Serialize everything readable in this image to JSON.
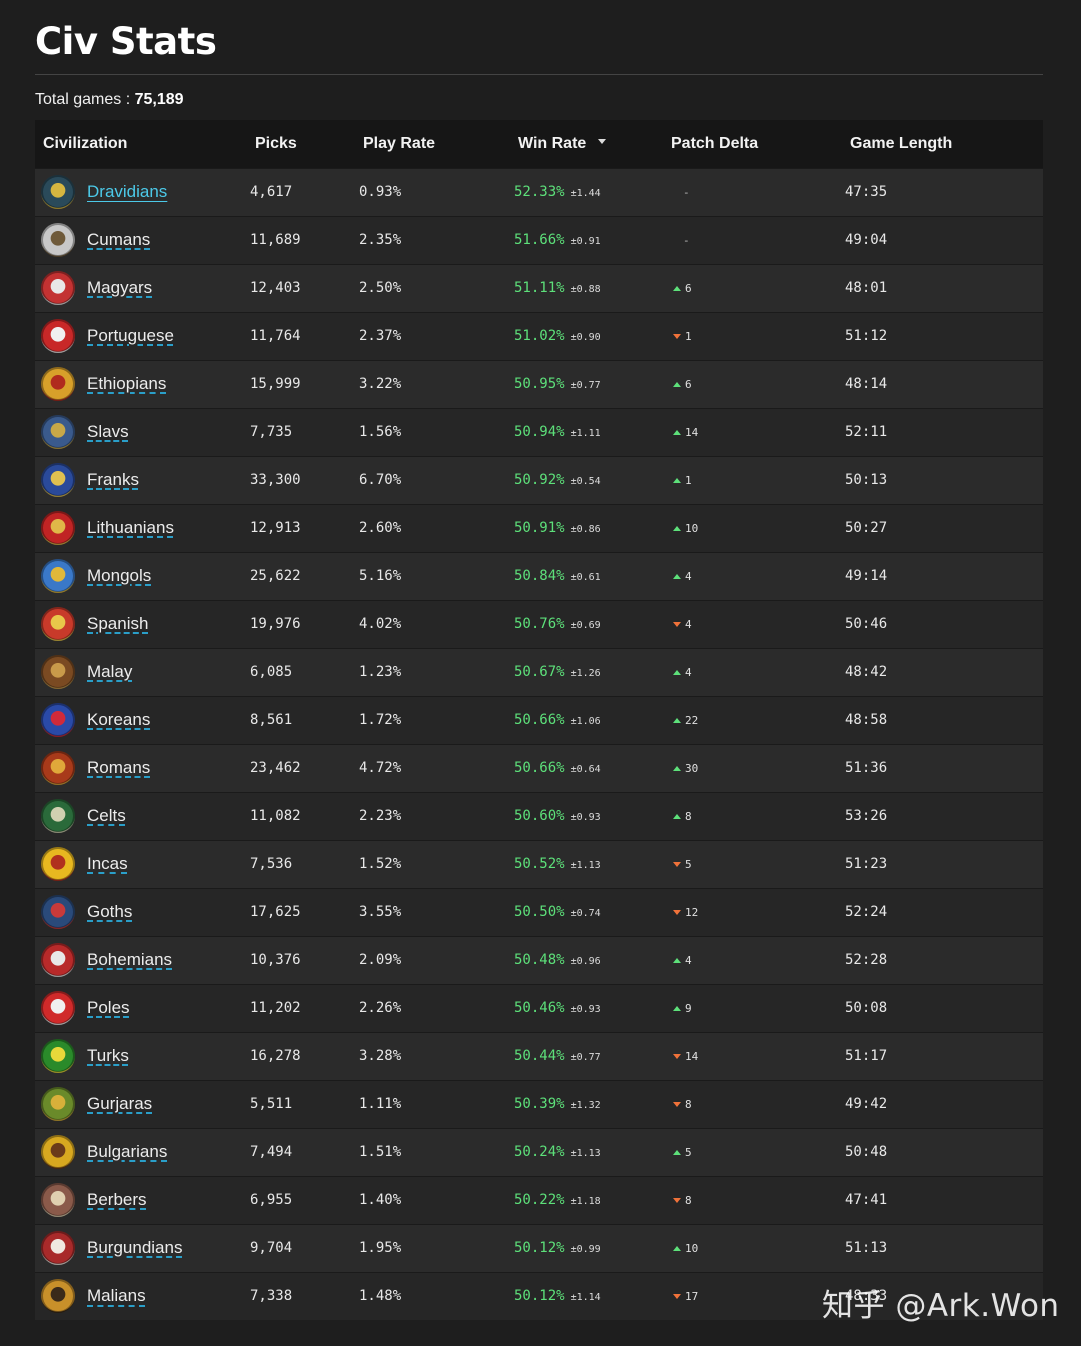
{
  "page": {
    "title": "Civ Stats",
    "total_label": "Total games : ",
    "total_value": "75,189"
  },
  "table": {
    "headers": {
      "civilization": "Civilization",
      "picks": "Picks",
      "play_rate": "Play Rate",
      "win_rate": "Win Rate",
      "patch_delta": "Patch Delta",
      "game_length": "Game Length"
    },
    "sorted_by": "win_rate",
    "rows": [
      {
        "civ": "Dravidians",
        "picks": "4,617",
        "play_rate": "0.93%",
        "win_rate": "52.33%",
        "ci": "±1.44",
        "delta_dir": "none",
        "delta": "-",
        "length": "47:35",
        "colors": [
          "#2a4a5a",
          "#d6b640"
        ]
      },
      {
        "civ": "Cumans",
        "picks": "11,689",
        "play_rate": "2.35%",
        "win_rate": "51.66%",
        "ci": "±0.91",
        "delta_dir": "none",
        "delta": "-",
        "length": "49:04",
        "colors": [
          "#c8c8c8",
          "#6f5a3a"
        ]
      },
      {
        "civ": "Magyars",
        "picks": "12,403",
        "play_rate": "2.50%",
        "win_rate": "51.11%",
        "ci": "±0.88",
        "delta_dir": "up",
        "delta": "6",
        "length": "48:01",
        "colors": [
          "#c33232",
          "#e8e8e8"
        ]
      },
      {
        "civ": "Portuguese",
        "picks": "11,764",
        "play_rate": "2.37%",
        "win_rate": "51.02%",
        "ci": "±0.90",
        "delta_dir": "down",
        "delta": "1",
        "length": "51:12",
        "colors": [
          "#c82828",
          "#f0f0f0"
        ]
      },
      {
        "civ": "Ethiopians",
        "picks": "15,999",
        "play_rate": "3.22%",
        "win_rate": "50.95%",
        "ci": "±0.77",
        "delta_dir": "up",
        "delta": "6",
        "length": "48:14",
        "colors": [
          "#d8a02a",
          "#b02a1e"
        ]
      },
      {
        "civ": "Slavs",
        "picks": "7,735",
        "play_rate": "1.56%",
        "win_rate": "50.94%",
        "ci": "±1.11",
        "delta_dir": "up",
        "delta": "14",
        "length": "52:11",
        "colors": [
          "#3a5a8c",
          "#c8a848"
        ]
      },
      {
        "civ": "Franks",
        "picks": "33,300",
        "play_rate": "6.70%",
        "win_rate": "50.92%",
        "ci": "±0.54",
        "delta_dir": "up",
        "delta": "1",
        "length": "50:13",
        "colors": [
          "#2a4a9a",
          "#e0c050"
        ]
      },
      {
        "civ": "Lithuanians",
        "picks": "12,913",
        "play_rate": "2.60%",
        "win_rate": "50.91%",
        "ci": "±0.86",
        "delta_dir": "up",
        "delta": "10",
        "length": "50:27",
        "colors": [
          "#c02424",
          "#e0b848"
        ]
      },
      {
        "civ": "Mongols",
        "picks": "25,622",
        "play_rate": "5.16%",
        "win_rate": "50.84%",
        "ci": "±0.61",
        "delta_dir": "up",
        "delta": "4",
        "length": "49:14",
        "colors": [
          "#3a78c8",
          "#e0b83a"
        ]
      },
      {
        "civ": "Spanish",
        "picks": "19,976",
        "play_rate": "4.02%",
        "win_rate": "50.76%",
        "ci": "±0.69",
        "delta_dir": "down",
        "delta": "4",
        "length": "50:46",
        "colors": [
          "#c83a2a",
          "#e8c84a"
        ]
      },
      {
        "civ": "Malay",
        "picks": "6,085",
        "play_rate": "1.23%",
        "win_rate": "50.67%",
        "ci": "±1.26",
        "delta_dir": "up",
        "delta": "4",
        "length": "48:42",
        "colors": [
          "#7a4a22",
          "#c89a4a"
        ]
      },
      {
        "civ": "Koreans",
        "picks": "8,561",
        "play_rate": "1.72%",
        "win_rate": "50.66%",
        "ci": "±1.06",
        "delta_dir": "up",
        "delta": "22",
        "length": "48:58",
        "colors": [
          "#2a4aa8",
          "#d02a3a"
        ]
      },
      {
        "civ": "Romans",
        "picks": "23,462",
        "play_rate": "4.72%",
        "win_rate": "50.66%",
        "ci": "±0.64",
        "delta_dir": "up",
        "delta": "30",
        "length": "51:36",
        "colors": [
          "#a83a1a",
          "#e0a83a"
        ]
      },
      {
        "civ": "Celts",
        "picks": "11,082",
        "play_rate": "2.23%",
        "win_rate": "50.60%",
        "ci": "±0.93",
        "delta_dir": "up",
        "delta": "8",
        "length": "53:26",
        "colors": [
          "#2a6a3a",
          "#d0d0b0"
        ]
      },
      {
        "civ": "Incas",
        "picks": "7,536",
        "play_rate": "1.52%",
        "win_rate": "50.52%",
        "ci": "±1.13",
        "delta_dir": "down",
        "delta": "5",
        "length": "51:23",
        "colors": [
          "#e8b820",
          "#b0301e"
        ]
      },
      {
        "civ": "Goths",
        "picks": "17,625",
        "play_rate": "3.55%",
        "win_rate": "50.50%",
        "ci": "±0.74",
        "delta_dir": "down",
        "delta": "12",
        "length": "52:24",
        "colors": [
          "#2a4a7a",
          "#c83a3a"
        ]
      },
      {
        "civ": "Bohemians",
        "picks": "10,376",
        "play_rate": "2.09%",
        "win_rate": "50.48%",
        "ci": "±0.96",
        "delta_dir": "up",
        "delta": "4",
        "length": "52:28",
        "colors": [
          "#b82a2a",
          "#e8e8e8"
        ]
      },
      {
        "civ": "Poles",
        "picks": "11,202",
        "play_rate": "2.26%",
        "win_rate": "50.46%",
        "ci": "±0.93",
        "delta_dir": "up",
        "delta": "9",
        "length": "50:08",
        "colors": [
          "#d02a2a",
          "#f0f0f0"
        ]
      },
      {
        "civ": "Turks",
        "picks": "16,278",
        "play_rate": "3.28%",
        "win_rate": "50.44%",
        "ci": "±0.77",
        "delta_dir": "down",
        "delta": "14",
        "length": "51:17",
        "colors": [
          "#2a8a2a",
          "#e8d83a"
        ]
      },
      {
        "civ": "Gurjaras",
        "picks": "5,511",
        "play_rate": "1.11%",
        "win_rate": "50.39%",
        "ci": "±1.32",
        "delta_dir": "down",
        "delta": "8",
        "length": "49:42",
        "colors": [
          "#6a8a2a",
          "#d8b03a"
        ]
      },
      {
        "civ": "Bulgarians",
        "picks": "7,494",
        "play_rate": "1.51%",
        "win_rate": "50.24%",
        "ci": "±1.13",
        "delta_dir": "up",
        "delta": "5",
        "length": "50:48",
        "colors": [
          "#d8a820",
          "#6a3a1a"
        ]
      },
      {
        "civ": "Berbers",
        "picks": "6,955",
        "play_rate": "1.40%",
        "win_rate": "50.22%",
        "ci": "±1.18",
        "delta_dir": "down",
        "delta": "8",
        "length": "47:41",
        "colors": [
          "#8a5a4a",
          "#e0d0b0"
        ]
      },
      {
        "civ": "Burgundians",
        "picks": "9,704",
        "play_rate": "1.95%",
        "win_rate": "50.12%",
        "ci": "±0.99",
        "delta_dir": "up",
        "delta": "10",
        "length": "51:13",
        "colors": [
          "#a82a2a",
          "#f0e8e0"
        ]
      },
      {
        "civ": "Malians",
        "picks": "7,338",
        "play_rate": "1.48%",
        "win_rate": "50.12%",
        "ci": "±1.14",
        "delta_dir": "down",
        "delta": "17",
        "length": "48:33",
        "colors": [
          "#c8902a",
          "#3a2a1a"
        ]
      }
    ]
  },
  "watermark": "知乎 @Ark.Won",
  "colors": {
    "background": "#1e1e1e",
    "win_rate": "#5de07a",
    "delta_up": "#5de07a",
    "delta_down": "#f0723a",
    "link_underline": "#2bb0e0",
    "active_link": "#4cc9e8"
  }
}
